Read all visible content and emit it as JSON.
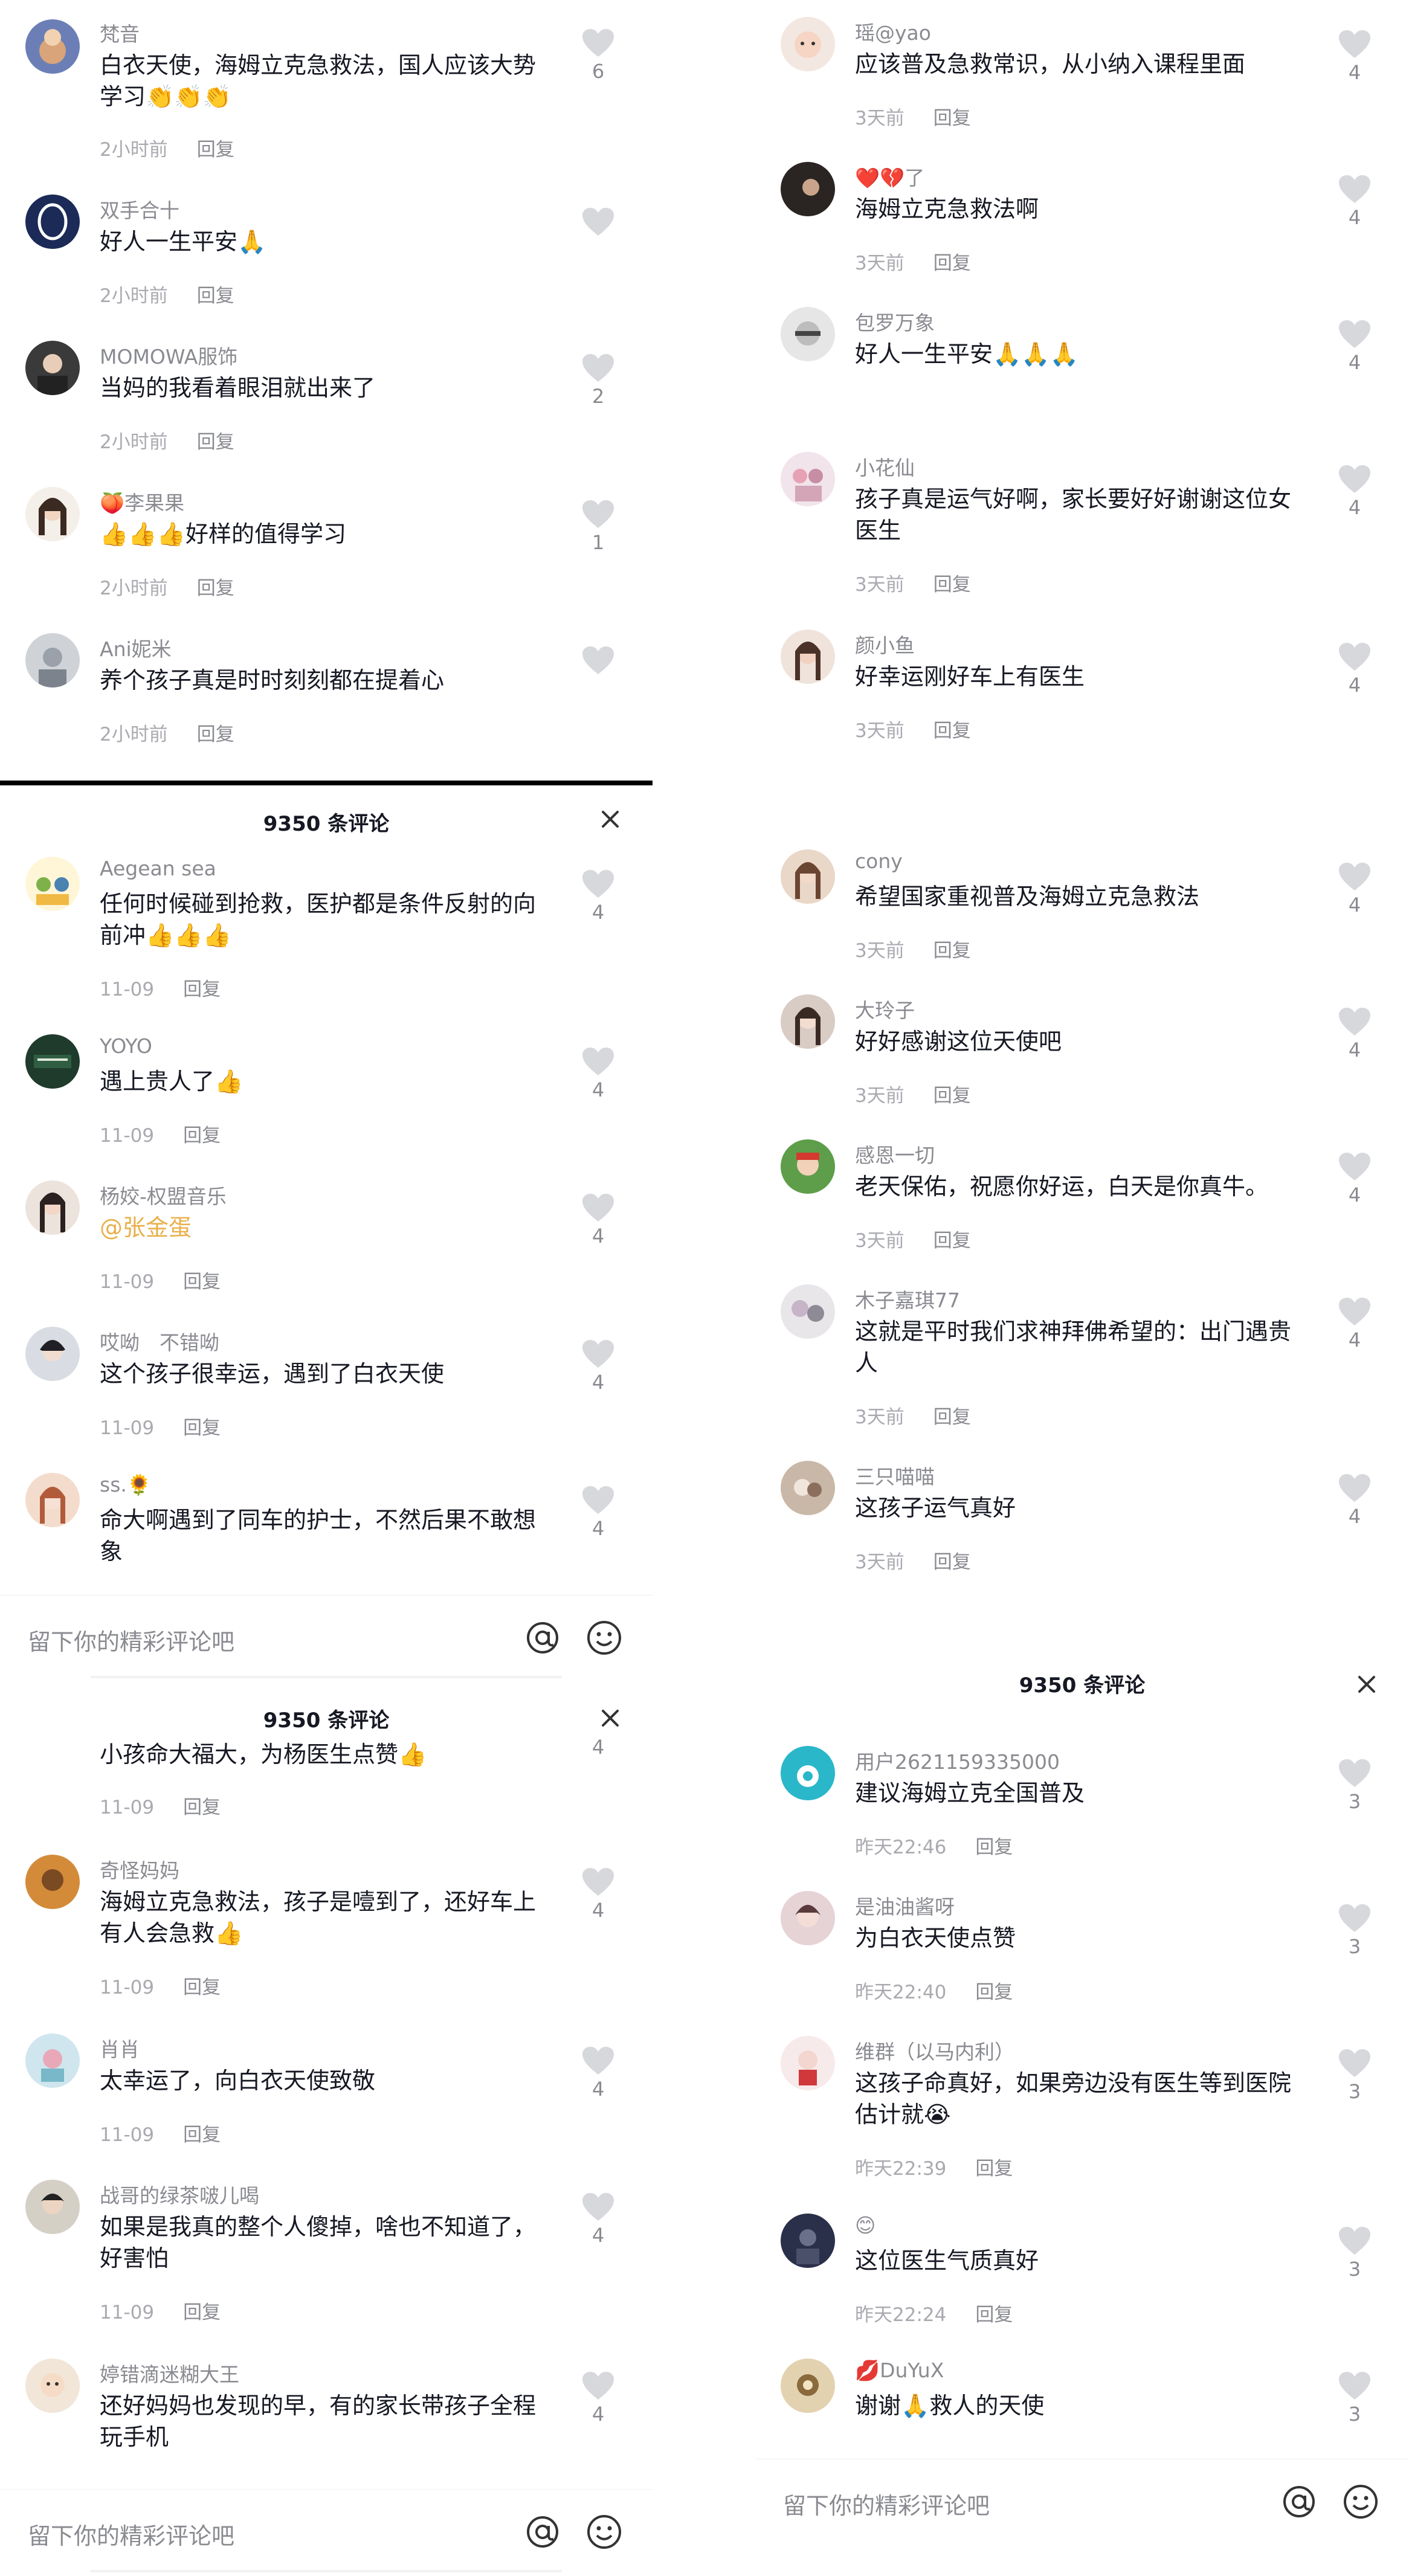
{
  "colors": {
    "accent": "#e8b04b",
    "text": "#161823",
    "meta": "#a9aab0",
    "username": "#8a8b91",
    "heart": "#d7d8dc"
  },
  "common": {
    "reply": "回复",
    "comment_count": "9350 条评论",
    "input_placeholder": "留下你的精彩评论吧"
  },
  "p1": {
    "comments": [
      {
        "user": "梵音",
        "text": "白衣天使，海姆立克急救法，国人应该大势学习👏👏👏",
        "time": "2小时前",
        "likes": "6"
      },
      {
        "user": "双手合十",
        "text": "好人一生平安🙏",
        "time": "2小时前",
        "likes": ""
      },
      {
        "user": "MOMOWA服饰",
        "text": "当妈的我看着眼泪就出来了",
        "time": "2小时前",
        "likes": "2"
      },
      {
        "user": "🍑李果果",
        "text": "👍👍👍好样的值得学习",
        "time": "2小时前",
        "likes": "1"
      },
      {
        "user": "Ani妮米",
        "text": "养个孩子真是时时刻刻都在提着心",
        "time": "2小时前",
        "likes": ""
      }
    ]
  },
  "p2": {
    "comments": [
      {
        "user": "瑶@yao",
        "text": "应该普及急救常识，从小纳入课程里面",
        "time": "3天前",
        "likes": "4"
      },
      {
        "user": "❤️💔了",
        "text": "海姆立克急救法啊",
        "time": "3天前",
        "likes": "4"
      },
      {
        "user": "包罗万象",
        "text": "好人一生平安🙏🙏🙏",
        "time": "3天前",
        "likes": "4"
      },
      {
        "user": "小花仙",
        "text": "孩子真是运气好啊，家长要好好谢谢这位女医生",
        "time": "3天前",
        "likes": "4"
      },
      {
        "user": "颜小鱼",
        "text": "好幸运刚好车上有医生",
        "time": "3天前",
        "likes": "4"
      }
    ]
  },
  "p3": {
    "comments": [
      {
        "user": "Aegean sea",
        "text": "任何时候碰到抢救，医护都是条件反射的向前冲👍👍👍",
        "time": "11-09",
        "likes": "4"
      },
      {
        "user": "YOYO",
        "text": "遇上贵人了👍",
        "time": "11-09",
        "likes": "4"
      },
      {
        "user": "杨姣-权盟音乐",
        "text": "@张金蛋",
        "time": "11-09",
        "likes": "4"
      },
      {
        "user": "哎呦　不错呦",
        "text": "这个孩子很幸运，遇到了白衣天使",
        "time": "11-09",
        "likes": "4"
      },
      {
        "user": "ss.🌻",
        "text": "命大啊遇到了同车的护士，不然后果不敢想象",
        "time": "",
        "likes": "4"
      }
    ]
  },
  "p4": {
    "comments": [
      {
        "user": "cony",
        "text": "希望国家重视普及海姆立克急救法",
        "time": "3天前",
        "likes": "4"
      },
      {
        "user": "大玲子",
        "text": "好好感谢这位天使吧",
        "time": "3天前",
        "likes": "4"
      },
      {
        "user": "感恩一切",
        "text": "老天保佑，祝愿你好运，白天是你真牛。",
        "time": "3天前",
        "likes": "4"
      },
      {
        "user": "木子嘉琪77",
        "text": "这就是平时我们求神拜佛希望的：出门遇贵人",
        "time": "3天前",
        "likes": "4"
      },
      {
        "user": "三只喵喵",
        "text": "这孩子运气真好",
        "time": "3天前",
        "likes": "4"
      }
    ]
  },
  "p5": {
    "comments": [
      {
        "user": "",
        "text": "小孩命大福大，为杨医生点赞👍",
        "time": "11-09",
        "likes": "4"
      },
      {
        "user": "奇怪妈妈",
        "text": "海姆立克急救法，孩子是噎到了，还好车上有人会急救👍",
        "time": "11-09",
        "likes": "4"
      },
      {
        "user": "肖肖",
        "text": "太幸运了，向白衣天使致敬",
        "time": "11-09",
        "likes": "4"
      },
      {
        "user": "战哥的绿茶啵儿喝",
        "text": "如果是我真的整个人傻掉，啥也不知道了，好害怕",
        "time": "11-09",
        "likes": "4"
      },
      {
        "user": "婷错滴迷糊大王",
        "text": "还好妈妈也发现的早，有的家长带孩子全程玩手机",
        "time": "",
        "likes": "4"
      }
    ]
  },
  "p6": {
    "comments": [
      {
        "user": "用户2621159335000",
        "text": "建议海姆立克全国普及",
        "time": "昨天22:46",
        "likes": "3"
      },
      {
        "user": "是油油酱呀",
        "text": "为白衣天使点赞",
        "time": "昨天22:40",
        "likes": "3"
      },
      {
        "user": "维群（以马内利）",
        "text": "这孩子命真好，如果旁边没有医生等到医院估计就😭",
        "time": "昨天22:39",
        "likes": "3"
      },
      {
        "user": "😊",
        "text": "这位医生气质真好",
        "time": "昨天22:24",
        "likes": "3"
      },
      {
        "user": "💋DuYuX",
        "text": "谢谢🙏救人的天使",
        "time": "",
        "likes": "3"
      }
    ]
  }
}
